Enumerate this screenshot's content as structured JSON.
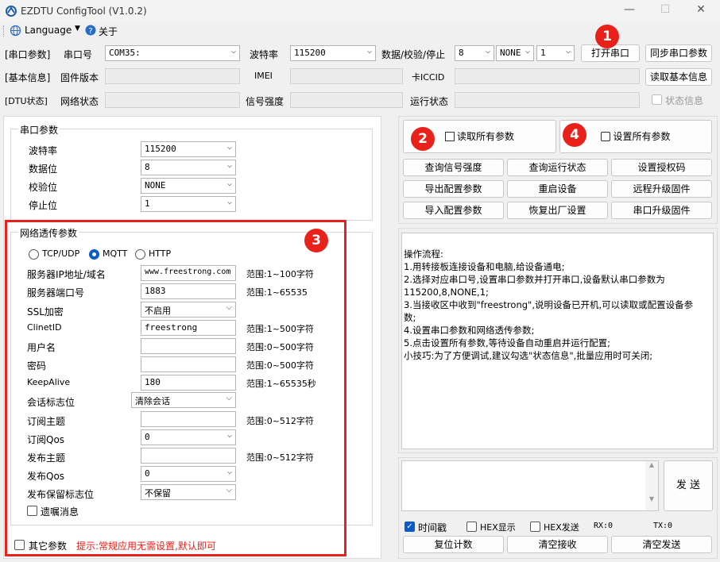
{
  "window": {
    "title": "EZDTU ConfigTool (V1.0.2)",
    "minimize": "—",
    "maximize": "☐",
    "close": "✕"
  },
  "menu": {
    "language": "Language",
    "about": "关于"
  },
  "row1": {
    "section": "[串口参数]",
    "port_label": "串口号",
    "port_value": "COM35:",
    "baud_label": "波特率",
    "baud_value": "115200",
    "dps_label": "数据/校验/停止",
    "data_bits": "8",
    "parity": "NONE",
    "stop_bits": "1",
    "open_button": "打开串口",
    "sync_button": "同步串口参数"
  },
  "row2": {
    "section": "[基本信息]",
    "fw_label": "固件版本",
    "imei_label": "IMEI",
    "iccid_label": "卡ICCID",
    "read_button": "读取基本信息"
  },
  "row3": {
    "section": "[DTU状态]",
    "net_label": "网络状态",
    "signal_label": "信号强度",
    "run_label": "运行状态",
    "status_checkbox": "状态信息"
  },
  "serial": {
    "title": "串口参数",
    "baud_label": "波特率",
    "baud": "115200",
    "data_label": "数据位",
    "data": "8",
    "parity_label": "校验位",
    "parity": "NONE",
    "stop_label": "停止位",
    "stop": "1"
  },
  "net": {
    "title": "网络透传参数",
    "proto_tcp": "TCP/UDP",
    "proto_mqtt": "MQTT",
    "proto_http": "HTTP",
    "server_label": "服务器IP地址/域名",
    "server": "www.freestrong.com",
    "server_hint": "范围:1~100字符",
    "port_label": "服务器端口号",
    "port": "1883",
    "port_hint": "范围:1~65535",
    "ssl_label": "SSL加密",
    "ssl": "不启用",
    "clientid_label": "ClinetID",
    "clientid": "freestrong",
    "clientid_hint": "范围:1~500字符",
    "user_label": "用户名",
    "user_hint": "范围:0~500字符",
    "pwd_label": "密码",
    "pwd_hint": "范围:0~500字符",
    "keepalive_label": "KeepAlive",
    "keepalive": "180",
    "keepalive_hint": "范围:1~65535秒",
    "session_label": "会话标志位",
    "session": "清除会话",
    "sub_topic_label": "订阅主题",
    "sub_topic_hint": "范围:0~512字符",
    "sub_qos_label": "订阅Qos",
    "sub_qos": "0",
    "pub_topic_label": "发布主题",
    "pub_topic_hint": "范围:0~512字符",
    "pub_qos_label": "发布Qos",
    "pub_qos": "0",
    "retain_label": "发布保留标志位",
    "retain": "不保留",
    "will_label": "遗嘱消息"
  },
  "other": {
    "label": "其它参数",
    "hint": "提示:常规应用无需设置,默认即可"
  },
  "right": {
    "read_all": "读取所有参数",
    "set_all": "设置所有参数",
    "buttons": [
      "查询信号强度",
      "查询运行状态",
      "设置授权码",
      "导出配置参数",
      "重启设备",
      "远程升级固件",
      "导入配置参数",
      "恢复出厂设置",
      "串口升级固件"
    ],
    "log": [
      "操作流程:",
      "1.用转接板连接设备和电脑,给设备通电;",
      "2.选择对应串口号,设置串口参数并打开串口,设备默认串口参数为",
      "115200,8,NONE,1;",
      "3.当接收区中收到\"freestrong\",说明设备已开机,可以读取或配置设备参",
      "数;",
      "4.设置串口参数和网络透传参数;",
      "5.点击设置所有参数,等待设备自动重启并运行配置;",
      "小技巧:为了方便调试,建议勾选\"状态信息\",批量应用时可关闭;"
    ],
    "send": "发 送",
    "timestamp": "时间戳",
    "hex_show": "HEX显示",
    "hex_send": "HEX发送",
    "rx": "RX:0",
    "tx": "TX:0",
    "reset_count": "复位计数",
    "clear_rx": "清空接收",
    "clear_tx": "清空发送"
  },
  "badges": [
    "1",
    "2",
    "3",
    "4"
  ],
  "colors": {
    "badge": "#e8211a",
    "accent": "#0b5cc9"
  }
}
